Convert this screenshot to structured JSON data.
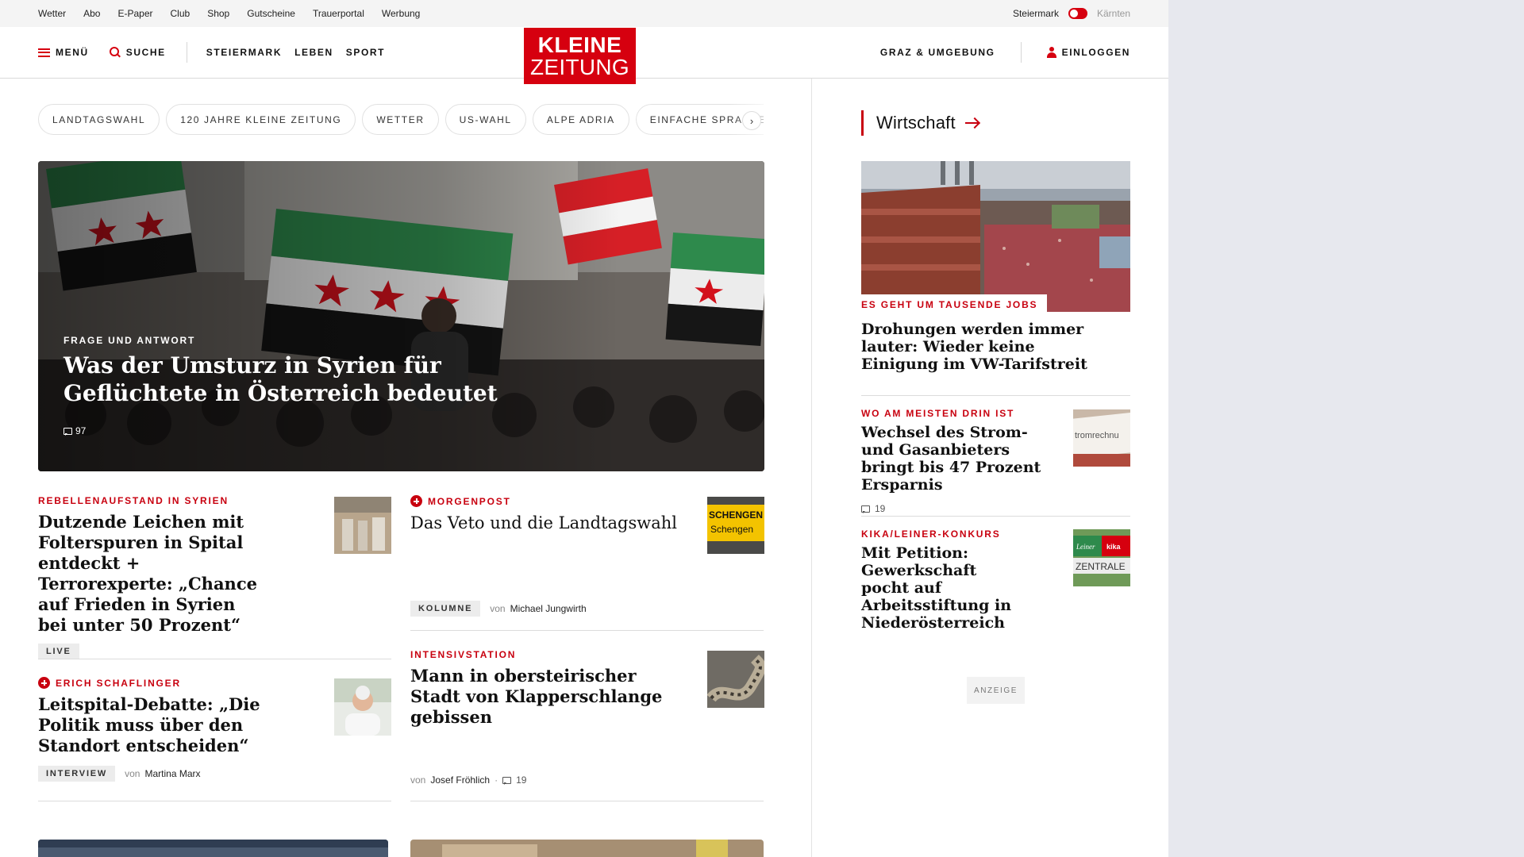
{
  "topbar": {
    "links": [
      "Wetter",
      "Abo",
      "E-Paper",
      "Club",
      "Shop",
      "Gutscheine",
      "Trauerportal",
      "Werbung"
    ],
    "region_active": "Steiermark",
    "region_inactive": "Kärnten"
  },
  "header": {
    "menu_label": "MENÜ",
    "search_label": "SUCHE",
    "nav": [
      "STEIERMARK",
      "LEBEN",
      "SPORT"
    ],
    "logo_line1": "KLEINE",
    "logo_line2": "ZEITUNG",
    "local_label": "GRAZ & UMGEBUNG",
    "login_label": "EINLOGGEN"
  },
  "topics": [
    "LANDTAGSWAHL",
    "120 JAHRE KLEINE ZEITUNG",
    "WETTER",
    "US-WAHL",
    "ALPE ADRIA",
    "EINFACHE SPRACHE"
  ],
  "topics_next_icon": "chevron-right-icon",
  "hero": {
    "kicker": "FRAGE UND ANTWORT",
    "title": "Was der Umsturz in Syrien für Geflüchtete in Österreich bedeutet",
    "comments": "97"
  },
  "articles": {
    "a1": {
      "kicker": "REBELLENAUFSTAND IN SYRIEN",
      "title": "Dutzende Leichen mit Folterspuren in Spital entdeckt + Terrorexperte: „Chance auf Frieden in Syrien bei unter 50 Prozent“",
      "tag": "LIVE"
    },
    "a2": {
      "kicker": "MORGENPOST",
      "title": "Das Veto und die Landtagswahl",
      "tag": "KOLUMNE",
      "von": "von",
      "author": "Michael Jungwirth",
      "thumb_text1": "SCHENGEN",
      "thumb_text2": "Schengen"
    },
    "a3": {
      "kicker": "ERICH SCHAFLINGER",
      "title": "Leitspital-Debatte: „Die Politik muss über den Standort entscheiden“",
      "tag": "INTERVIEW",
      "von": "von",
      "author": "Martina Marx"
    },
    "a4": {
      "kicker": "INTENSIVSTATION",
      "title": "Mann in obersteirischer Stadt von Klapperschlange gebissen",
      "von": "von",
      "author": "Josef Fröhlich",
      "sep": "·",
      "comments": "19"
    }
  },
  "sidebar": {
    "section_title": "Wirtschaft",
    "lead": {
      "kicker": "ES GEHT UM TAUSENDE JOBS",
      "title": "Drohungen werden immer lauter: Wieder keine Einigung im VW-Tarifstreit"
    },
    "item2": {
      "kicker": "WO AM MEISTEN DRIN IST",
      "title": "Wechsel des Strom- und Gasanbieters bringt bis 47 Prozent Ersparnis",
      "comments": "19",
      "thumb_text": "tromrechnu"
    },
    "item3": {
      "kicker": "KIKA/LEINER-KONKURS",
      "title": "Mit Petition: Gewerkschaft pocht auf Arbeitsstiftung in Niederösterreich",
      "thumb_text1": "Leiner",
      "thumb_text2": "kika",
      "thumb_text3": "ZENTRALE"
    },
    "ad_label": "ANZEIGE"
  },
  "colors": {
    "brand_red": "#d6000f",
    "kicker_red": "#c8000f"
  }
}
